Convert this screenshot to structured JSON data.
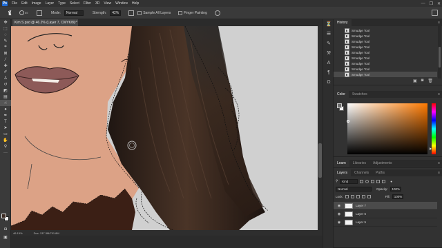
{
  "app": {
    "logo_text": "Ps",
    "menu": [
      "File",
      "Edit",
      "Image",
      "Layer",
      "Type",
      "Select",
      "Filter",
      "3D",
      "View",
      "Window",
      "Help"
    ],
    "window_controls": {
      "minimize": "—",
      "restore": "❐",
      "close": "✕"
    }
  },
  "options_bar": {
    "brush_size": "65",
    "mode_label": "Mode:",
    "mode_value": "Normal",
    "strength_label": "Strength:",
    "strength_value": "42%",
    "sample_all_layers": "Sample All Layers",
    "finger_painting": "Finger Painting"
  },
  "document": {
    "tab_title": "Kim S.psd @ 46.2% (Layer 7, CMYK/8) *",
    "close": "×"
  },
  "status": {
    "zoom": "46.15%",
    "doc_size": "Doc: 137.3M/791.8M"
  },
  "history": {
    "tab_label": "History",
    "items": [
      "Smudge Tool",
      "Smudge Tool",
      "Smudge Tool",
      "Smudge Tool",
      "Smudge Tool",
      "Smudge Tool",
      "Smudge Tool",
      "Smudge Tool",
      "Smudge Tool"
    ],
    "selected_index": 8
  },
  "color": {
    "tabs": [
      "Color",
      "Swatches"
    ],
    "hue_color": "#ff7a00",
    "foreground": "#6d6d6d",
    "background": "#f2f2f2"
  },
  "learn_tabs": [
    "Learn",
    "Libraries",
    "Adjustments"
  ],
  "layers": {
    "tabs": [
      "Layers",
      "Channels",
      "Paths"
    ],
    "filter_placeholder": "Kind",
    "blend_mode": "Normal",
    "opacity_label": "Opacity:",
    "opacity_value": "100%",
    "lock_label": "Lock:",
    "fill_label": "Fill:",
    "fill_value": "100%",
    "items": [
      {
        "name": "Layer 7",
        "visible": true,
        "selected": true
      },
      {
        "name": "Layer 6",
        "visible": true,
        "selected": false
      },
      {
        "name": "Layer 5",
        "visible": true,
        "selected": false
      }
    ]
  },
  "colors": {
    "skin": "#dca286",
    "hair": "#2c1e17",
    "lips": "#8d5a58",
    "canvas_bg": "#d0d0d0"
  }
}
